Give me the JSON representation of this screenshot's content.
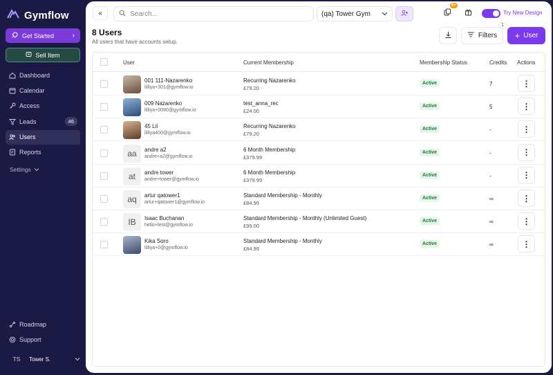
{
  "brand": {
    "name": "Gymflow"
  },
  "sidebar": {
    "get_started": "Get Started",
    "sell_item": "Sell Item",
    "items": [
      {
        "label": "Dashboard",
        "icon": "home-icon"
      },
      {
        "label": "Calendar",
        "icon": "calendar-icon"
      },
      {
        "label": "Access",
        "icon": "key-icon"
      },
      {
        "label": "Leads",
        "icon": "funnel-icon",
        "badge": "46"
      },
      {
        "label": "Users",
        "icon": "users-icon",
        "active": true
      },
      {
        "label": "Reports",
        "icon": "reports-icon"
      }
    ],
    "settings": "Settings",
    "bottom": [
      {
        "label": "Roadmap",
        "icon": "roadmap-icon"
      },
      {
        "label": "Support",
        "icon": "support-icon"
      }
    ],
    "user": {
      "initials": "TS",
      "name": "Tower S."
    }
  },
  "topbar": {
    "search_placeholder": "Search...",
    "gym": "(qa) Tower Gym",
    "notif_badge": "9+",
    "try_design": "Try New Design"
  },
  "page": {
    "title": "8 Users",
    "subtitle": "All users that have accounts setup.",
    "filters_label": "Filters",
    "filters_count": "1",
    "user_button": "User"
  },
  "table": {
    "headers": {
      "user": "User",
      "membership": "Current Membership",
      "status": "Membership Status",
      "credits": "Credits",
      "actions": "Actions"
    },
    "rows": [
      {
        "name": "001 111-Nazarenko",
        "email": "lilliya+301@gymflow.io",
        "membership": "Recurring Nazarenko",
        "price": "£79.20",
        "status": "Active",
        "credits": "7",
        "avatar": "photo"
      },
      {
        "name": "009 Nazarenko",
        "email": "lilliya+0090@gymflow.io",
        "membership": "test_anna_rec",
        "price": "£24.00",
        "status": "Active",
        "credits": "5",
        "avatar": "photo"
      },
      {
        "name": "45 Lil",
        "email": "lilliya400@gymflow.io",
        "membership": "Recurring Nazarenko",
        "price": "£79.20",
        "status": "Active",
        "credits": "-",
        "avatar": "photo"
      },
      {
        "name": "andre a2",
        "email": "andre+a2@gymflow.io",
        "membership": "6 Month Membership",
        "price": "£379.99",
        "status": "Active",
        "credits": "-",
        "avatar": "aa"
      },
      {
        "name": "andre tower",
        "email": "andre+tower@gymflow.io",
        "membership": "6 Month Membership",
        "price": "£379.99",
        "status": "Active",
        "credits": "-",
        "avatar": "at"
      },
      {
        "name": "artur qatower1",
        "email": "artur+qatower1@gymflow.io",
        "membership": "Standard Membership - Monthly",
        "price": "£84.99",
        "status": "Active",
        "credits": "∞",
        "avatar": "aq"
      },
      {
        "name": "Isaac Buchanan",
        "email": "hello+test@gymflow.io",
        "membership": "Standard Membership - Monthly (Unlimited Guest)",
        "price": "£99.00",
        "status": "Active",
        "credits": "∞",
        "avatar": "IB"
      },
      {
        "name": "Kika Soro",
        "email": "lilliya+0@gymflow.io",
        "membership": "Standard Membership - Monthly",
        "price": "£84.99",
        "status": "Active",
        "credits": "∞",
        "avatar": "photo"
      }
    ]
  },
  "colors": {
    "accent": "#7c3aed",
    "sidebar_bg": "#1b1a44",
    "active_badge_bg": "#e6f6ea",
    "active_badge_text": "#1e7a38"
  }
}
